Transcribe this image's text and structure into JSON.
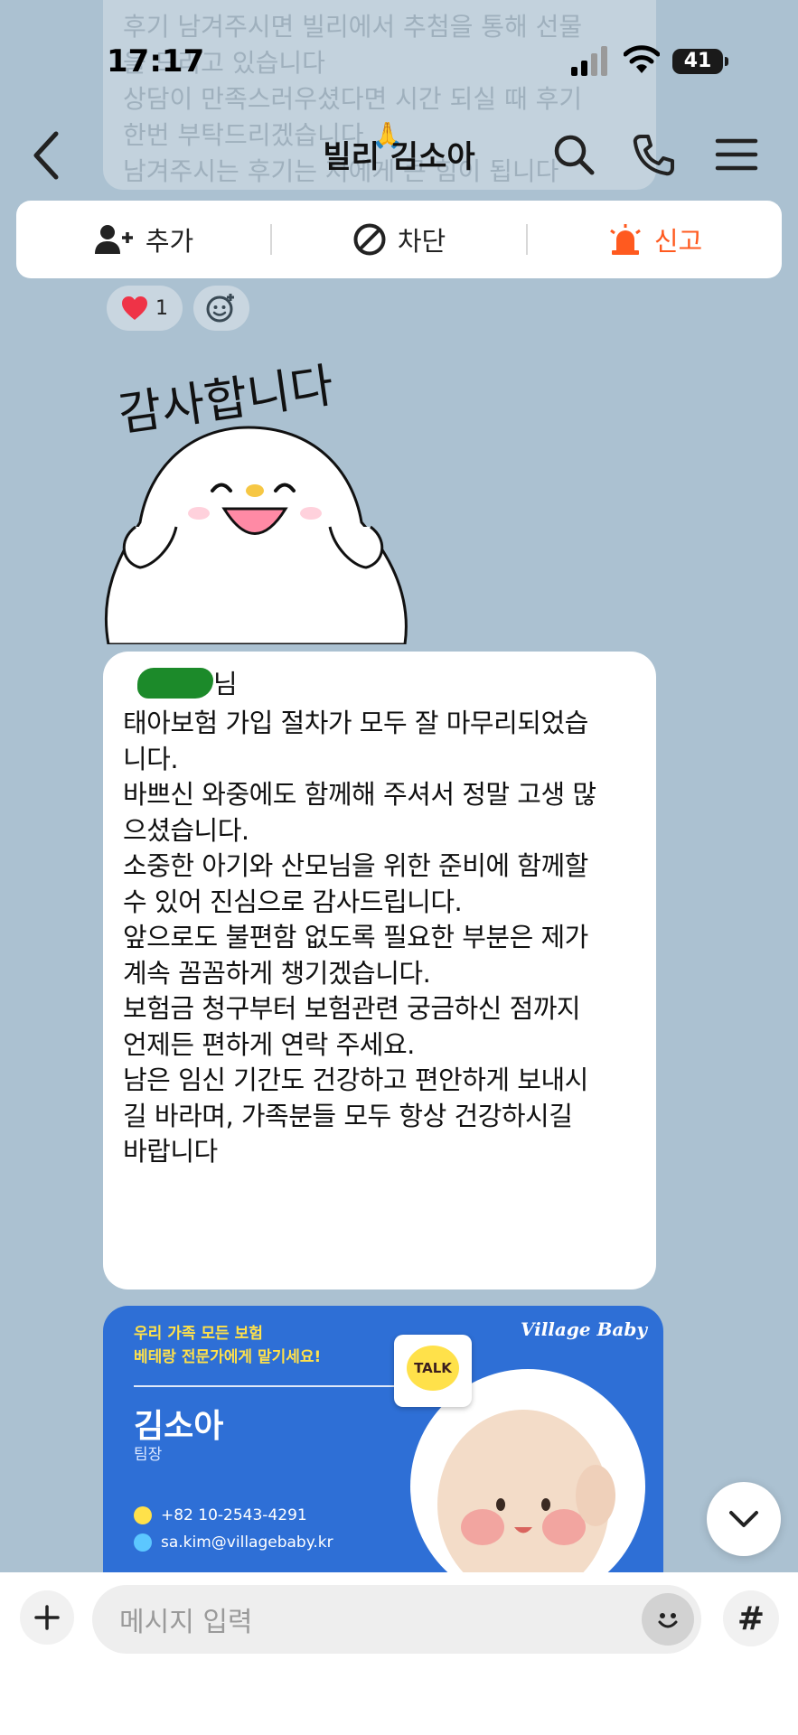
{
  "status_bar": {
    "time": "17:17",
    "battery": "41"
  },
  "previous_message": {
    "lines": [
      "후기 남겨주시면 빌리에서 추첨을 통해 선물",
      "을 드리고 있습니다",
      "상담이 만족스러우셨다면 시간 되실 때 후기",
      "한번 부탁드리겠습니다 🙏",
      "남겨주시는 후기는 저에게 큰 힘이 됩니다"
    ]
  },
  "header": {
    "title": "빌리 김소아"
  },
  "action_bar": {
    "add_label": "추가",
    "block_label": "차단",
    "report_label": "신고"
  },
  "reaction": {
    "heart_count": "1"
  },
  "sticker": {
    "text": "감사합니다"
  },
  "message": {
    "name_suffix": "님",
    "lines": [
      "태아보험 가입 절차가 모두 잘 마무리되었습",
      "니다.",
      "바쁘신 와중에도 함께해 주셔서 정말 고생 많",
      "으셨습니다.",
      "",
      "소중한 아기와 산모님을 위한 준비에 함께할",
      "수 있어 진심으로 감사드립니다.",
      "앞으로도 불편함 없도록 필요한 부분은 제가",
      "계속 꼼꼼하게 챙기겠습니다.",
      "",
      "보험금 청구부터 보험관련 궁금하신 점까지",
      "언제든 편하게 연락 주세요.",
      "",
      "남은 임신 기간도 건강하고 편안하게 보내시",
      "길 바라며, 가족분들 모두 항상 건강하시길",
      "바랍니다"
    ]
  },
  "business_card": {
    "tagline_1": "우리 가족 모든 보험",
    "tagline_2": "베테랑 전문가에게 맡기세요!",
    "brand": "Village Baby",
    "name": "김소아",
    "role": "팀장",
    "phone": "+82 10-2543-4291",
    "email": "sa.kim@villagebaby.kr",
    "talk_badge": "TALK"
  },
  "input_bar": {
    "placeholder": "메시지 입력",
    "hash_label": "#"
  }
}
